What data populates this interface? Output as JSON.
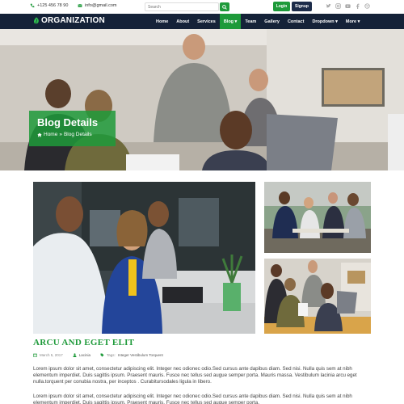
{
  "topbar": {
    "phone": "+125 456 78 90",
    "email": "info@gmail.com",
    "search_placeholder": "Search",
    "login_label": "Login",
    "signup_label": "Signup",
    "socials": [
      "twitter-icon",
      "instagram-icon",
      "youtube-icon",
      "facebook-icon",
      "dribbble-icon"
    ]
  },
  "navbar": {
    "logo_text": "ORGANIZATION",
    "items": [
      {
        "label": "Home"
      },
      {
        "label": "About"
      },
      {
        "label": "Services"
      },
      {
        "label": "Blog ▾",
        "active": true
      },
      {
        "label": "Team"
      },
      {
        "label": "Gallery"
      },
      {
        "label": "Contact"
      },
      {
        "label": "Dropdown ▾"
      },
      {
        "label": "More ▾"
      }
    ]
  },
  "hero": {
    "title": "Blog Details",
    "crumb_home": "Home",
    "crumb_sep": "»",
    "crumb_current": "Blog Details"
  },
  "post": {
    "title": "ARCU AND EGET ELIT",
    "date": "March 5, 2017",
    "author": "Lacinia",
    "tags_label": "Tags:",
    "tags": "Integer  Vestibulum  Torquent",
    "paragraphs": [
      "Lorem ipsum dolor sit amet, consectetur adipiscing elit. Integer nec odionec odio.Sed cursus ante dapibus diam. Sed nisi. Nulla quis sem at nibh elementum imperdiet. Duis sagittis ipsum. Praesent mauris. Fusce nec tellus sed augue semper porta. Mauris massa. Vestibulum lacinia arcu eget nulla.torquent per conubia nostra, per inceptos . Curabitursodales ligula in libero.",
      "Lorem ipsum dolor sit amet, consectetur adipiscing elit. Integer nec odionec odio.Sed cursus ante dapibus diam. Sed nisi. Nulla quis sem at nibh elementum imperdiet. Duis sagittis ipsum. Praesent mauris. Fusce nec tellus sed augue semper porta."
    ]
  },
  "colors": {
    "accent": "#1e9a3a",
    "navbar": "#152238",
    "signup": "#1d2c4a"
  }
}
